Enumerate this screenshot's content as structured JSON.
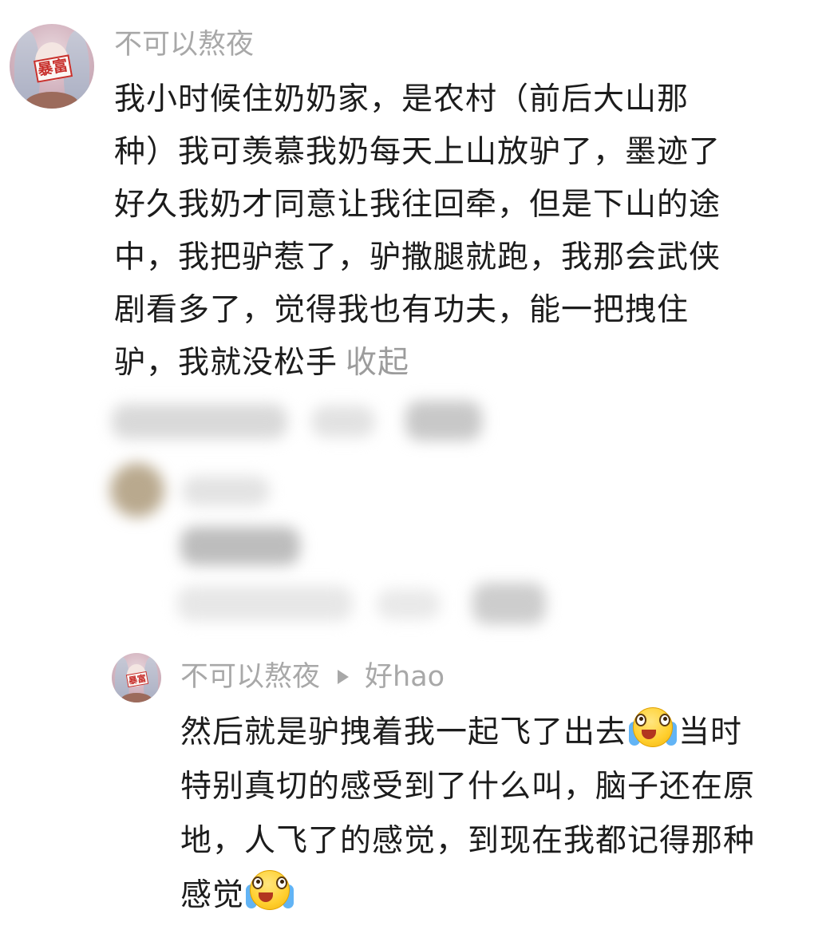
{
  "comment": {
    "avatar_text": "暴富",
    "username": "不可以熬夜",
    "lines": [
      "我小时候住奶奶家，是农村（前后大山那",
      "种）我可羡慕我奶每天上山放驴了，墨迹了",
      "好久我奶才同意让我往回牵，但是下山的途",
      "中，我把驴惹了，驴撒腿就跑，我那会武侠",
      "剧看多了，觉得我也有功夫，能一把拽住",
      "驴，我就没松手"
    ],
    "collapse_label": "收起"
  },
  "reply": {
    "avatar_text": "暴富",
    "username": "不可以熬夜",
    "reply_to": "好hao",
    "lines": [
      {
        "before": "然后就是驴拽着我一起飞了出去",
        "emoji": "crying-laughing-emoji",
        "after": "当时"
      },
      {
        "before": "特别真切的感受到了什么叫，脑子还在原"
      },
      {
        "before": "地，人飞了的感觉，到现在我都记得那种"
      },
      {
        "before": "感觉",
        "emoji": "crying-laughing-emoji"
      }
    ]
  },
  "colors": {
    "username": "#a8a8a8",
    "body_text": "#1c1c1c",
    "collapse": "#9c9c9c",
    "accent_red": "#c8302c"
  }
}
